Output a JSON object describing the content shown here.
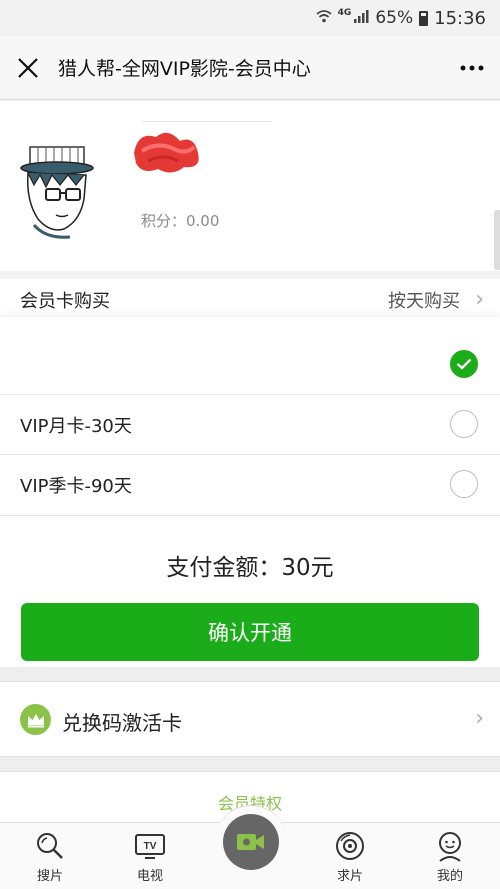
{
  "statusbar": {
    "network": "4G",
    "battery": "65%",
    "time": "15:36"
  },
  "navbar": {
    "title": "猎人帮-全网VIP影院-会员中心"
  },
  "profile": {
    "points": "积分：0.00"
  },
  "purchase": {
    "header_label": "会员卡购买",
    "header_right": "按天购买",
    "options": [
      {
        "label": "VIP月卡-30天",
        "selected": false
      },
      {
        "label": "VIP季卡-90天",
        "selected": false
      }
    ]
  },
  "payment": {
    "amount": "支付金额：30元",
    "confirm_label": "确认开通"
  },
  "redeem": {
    "label": "兑换码激活卡"
  },
  "privilege": {
    "label": "会员特权"
  },
  "tabbar": {
    "items": [
      {
        "label": "搜片",
        "icon": "search-icon"
      },
      {
        "label": "电视",
        "icon": "tv-icon"
      },
      {
        "label": "",
        "icon": "video-camera-icon"
      },
      {
        "label": "求片",
        "icon": "request-icon"
      },
      {
        "label": "我的",
        "icon": "profile-icon"
      }
    ]
  },
  "colors": {
    "accent": "#1aad19",
    "crown": "#8bc34a"
  }
}
